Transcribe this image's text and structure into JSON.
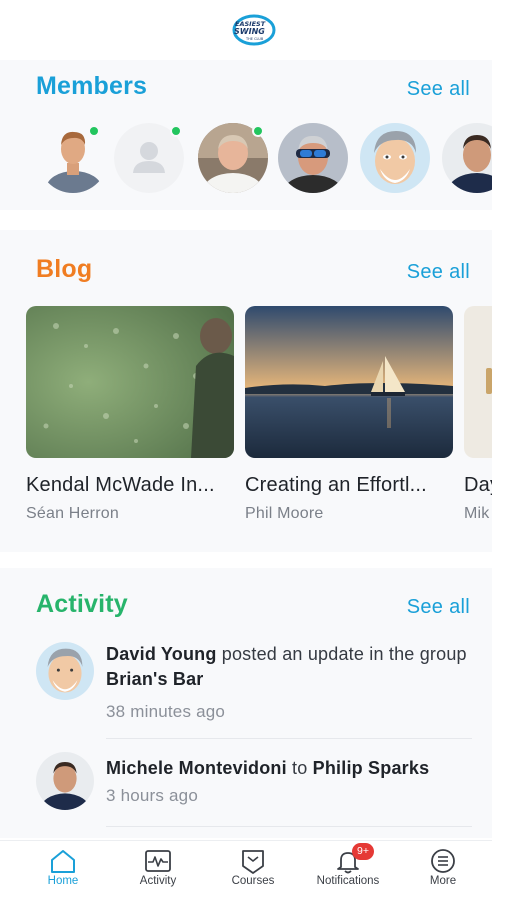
{
  "colors": {
    "members_title": "#1aa0d8",
    "blog_title": "#f07d22",
    "activity_title": "#27b46b",
    "see_all": "#1aa0d8",
    "tab_active": "#1aa0d8",
    "online": "#22c55e",
    "badge": "#e53935"
  },
  "members": {
    "title": "Members",
    "see_all": "See all",
    "avatars": [
      {
        "icon": "member-photo-1",
        "online": true
      },
      {
        "icon": "default-user-icon",
        "online": true
      },
      {
        "icon": "member-photo-3",
        "online": true
      },
      {
        "icon": "member-photo-4",
        "online": false
      },
      {
        "icon": "member-cartoon-5",
        "online": false
      },
      {
        "icon": "member-photo-6",
        "online": false
      }
    ]
  },
  "blog": {
    "title": "Blog",
    "see_all": "See all",
    "posts": [
      {
        "title": "Kendal McWade In...",
        "author": "Séan Herron"
      },
      {
        "title": "Creating an Effortl...",
        "author": "Phil Moore"
      },
      {
        "title": "Day",
        "author": "Mik"
      }
    ]
  },
  "activity": {
    "title": "Activity",
    "see_all": "See all",
    "items": [
      {
        "actor": "David Young",
        "verb": " posted an update in the group ",
        "target": "Brian's Bar",
        "time": "38 minutes ago"
      },
      {
        "actor": "Michele Montevidoni",
        "verb": " to ",
        "target": "Philip Sparks",
        "time": "3 hours ago"
      }
    ]
  },
  "tabbar": {
    "tabs": [
      {
        "label": "Home",
        "icon": "home-icon",
        "active": true
      },
      {
        "label": "Activity",
        "icon": "activity-icon",
        "active": false
      },
      {
        "label": "Courses",
        "icon": "courses-icon",
        "active": false
      },
      {
        "label": "Notifications",
        "icon": "bell-icon",
        "active": false,
        "badge": "9+"
      },
      {
        "label": "More",
        "icon": "more-icon",
        "active": false
      }
    ]
  }
}
